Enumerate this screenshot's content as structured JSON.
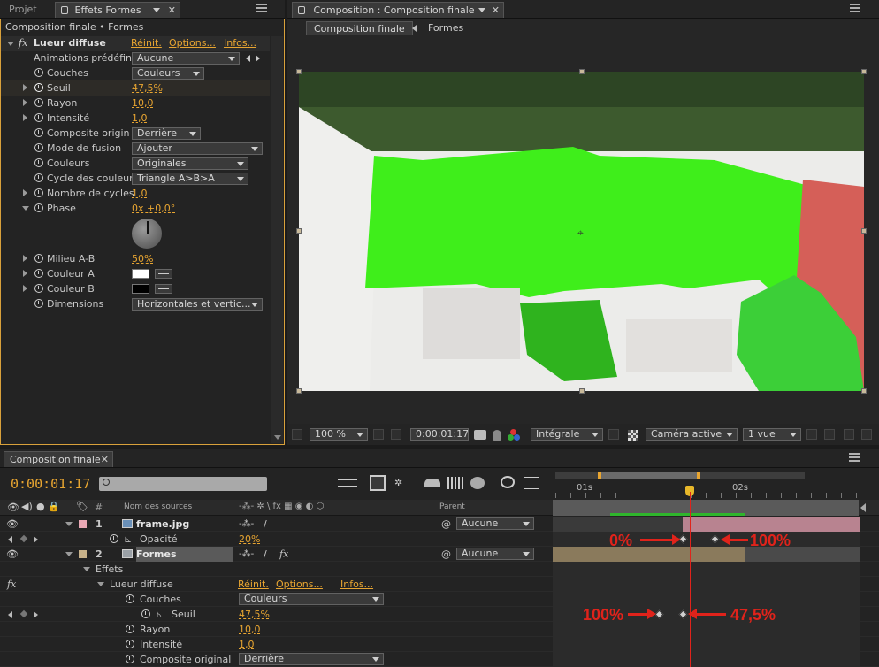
{
  "left_panel": {
    "tab_project": "Projet",
    "tab_effects": "Effets Formes",
    "breadcrumb": "Composition finale • Formes",
    "effect_name": "Lueur diffuse",
    "reset": "Réinit.",
    "options": "Options...",
    "infos": "Infos...",
    "props": [
      {
        "label": "Animations prédéfini",
        "value": "Aucune",
        "kind": "dropdown"
      },
      {
        "label": "Couches",
        "value": "Couleurs",
        "kind": "dropdown"
      },
      {
        "label": "Seuil",
        "value": "47,5%",
        "kind": "number"
      },
      {
        "label": "Rayon",
        "value": "10,0",
        "kind": "number"
      },
      {
        "label": "Intensité",
        "value": "1,0",
        "kind": "number"
      },
      {
        "label": "Composite origin",
        "value": "Derrière",
        "kind": "dropdown"
      },
      {
        "label": "Mode de fusion",
        "value": "Ajouter",
        "kind": "dropdown"
      },
      {
        "label": "Couleurs",
        "value": "Originales",
        "kind": "dropdown"
      },
      {
        "label": "Cycle des couleur",
        "value": "Triangle A>B>A",
        "kind": "dropdown"
      },
      {
        "label": "Nombre de cycles",
        "value": "1,0",
        "kind": "number"
      },
      {
        "label": "Phase",
        "value": "0x +0,0°",
        "kind": "number"
      },
      {
        "label": "Milieu A-B",
        "value": "50%",
        "kind": "number"
      },
      {
        "label": "Couleur A",
        "value": "#ffffff",
        "kind": "color"
      },
      {
        "label": "Couleur B",
        "value": "#000000",
        "kind": "color"
      },
      {
        "label": "Dimensions",
        "value": "Horizontales et vertic...",
        "kind": "dropdown"
      }
    ]
  },
  "comp_panel": {
    "tab": "Composition : Composition finale",
    "breadcrumb_active": "Composition finale",
    "breadcrumb_next": "Formes",
    "zoom": "100 %",
    "timecode": "0:00:01:17",
    "resolution": "Intégrale",
    "camera": "Caméra active",
    "views": "1 vue"
  },
  "timeline": {
    "tab": "Composition finale",
    "timecode": "0:00:01:17",
    "col_source": "Nom des sources",
    "col_parent": "Parent",
    "ruler": [
      "01s",
      "02s"
    ],
    "layers": [
      {
        "num": "1",
        "name": "frame.jpg",
        "parent": "Aucune",
        "label_color": "#e9a8b4"
      },
      {
        "num": "2",
        "name": "Formes",
        "parent": "Aucune",
        "label_color": "#c8b28a"
      }
    ],
    "opacity_label": "Opacité",
    "opacity_value": "20%",
    "effects_label": "Effets",
    "effect_name": "Lueur diffuse",
    "reset": "Réinit.",
    "options": "Options...",
    "infos": "Infos...",
    "channels_label": "Couches",
    "channels_value": "Couleurs",
    "threshold_label": "Seuil",
    "threshold_value": "47,5%",
    "radius_label": "Rayon",
    "radius_value": "10,0",
    "intensity_label": "Intensité",
    "intensity_value": "1,0",
    "composite_label": "Composite original",
    "composite_value": "Derrière",
    "annotations": {
      "opacity_start": "0%",
      "opacity_end": "100%",
      "threshold_start": "100%",
      "threshold_end": "47,5%"
    }
  }
}
